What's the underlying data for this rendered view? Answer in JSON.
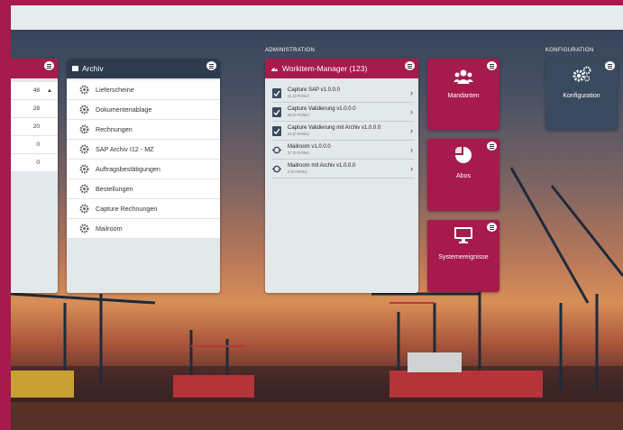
{
  "sections": {
    "administration": "ADMINISTRATION",
    "configuration": "KONFIGURATION"
  },
  "left_panel": {
    "values": [
      "48",
      "28",
      "20",
      "0",
      "0"
    ]
  },
  "archiv": {
    "title": "Archiv",
    "items": [
      "Lieferscheine",
      "Dokumentenablage",
      "Rechnungen",
      "SAP Archiv I12 - MZ",
      "Auftragsbestätigungen",
      "Bestellungen",
      "Capture Rechnungen",
      "Mailroom"
    ]
  },
  "workitem": {
    "title": "Workitem-Manager (123)",
    "items": [
      {
        "title": "Capture SAP v1.0.0.0",
        "sub": "21 (0 Fehler)",
        "icon": "check-icon"
      },
      {
        "title": "Capture Validierung v1.0.0.0",
        "sub": "48 (0 Fehler)",
        "icon": "check-icon"
      },
      {
        "title": "Capture Validierung mit Archiv v1.0.0.0",
        "sub": "24 (0 Fehler)",
        "icon": "check-icon"
      },
      {
        "title": "Mailroom v1.0.0.0",
        "sub": "27 (0 Fehler)",
        "icon": "route-icon"
      },
      {
        "title": "Mailroom mit Archiv v1.0.0.0",
        "sub": "3 (0 Fehler)",
        "icon": "route-icon"
      }
    ]
  },
  "tiles": {
    "mandanten": "Mandanten",
    "abos": "Abos",
    "systemereignisse": "Systemereignisse",
    "konfiguration": "Konfiguration"
  },
  "colors": {
    "brand": "#a61a4c",
    "archiv_header": "#2e3b4e",
    "workitem_header": "#a61a4c",
    "tile_config": "#3a4a5e"
  }
}
